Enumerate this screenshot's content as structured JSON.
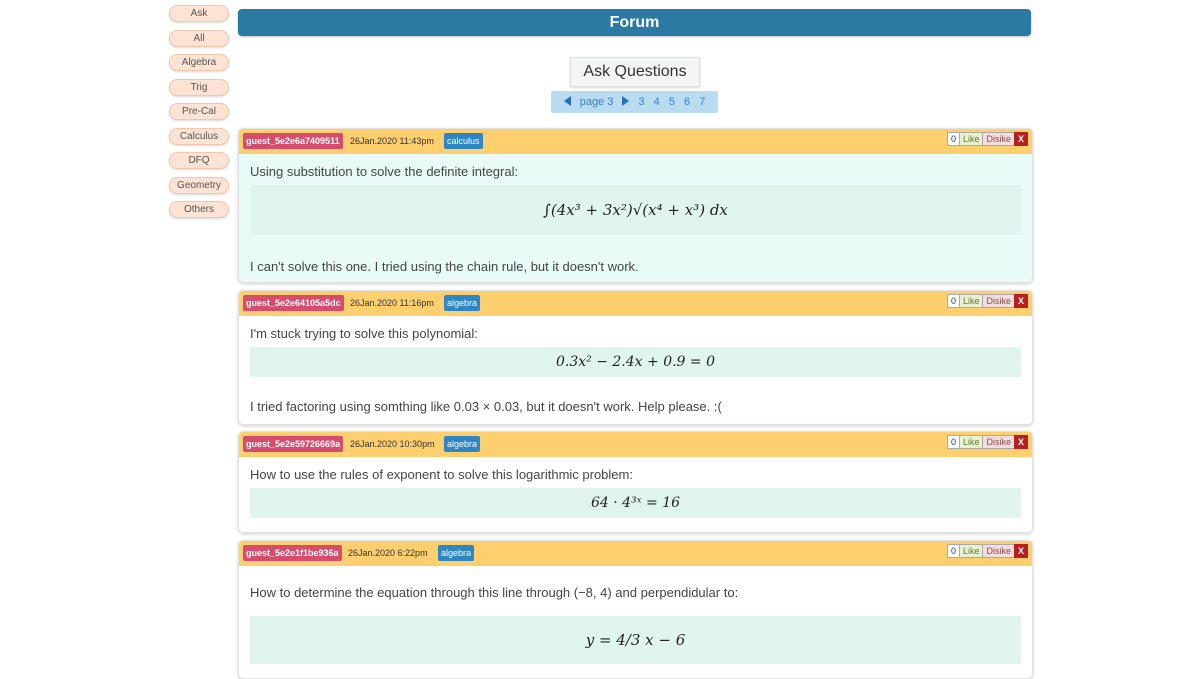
{
  "sidebar": {
    "items": [
      "Ask",
      "All",
      "Algebra",
      "Trig",
      "Pre-Cal",
      "Calculus",
      "DFQ",
      "Geometry",
      "Others"
    ]
  },
  "header": {
    "title": "Forum"
  },
  "ask_button": "Ask Questions",
  "pagination": {
    "current": "page 3",
    "pages": [
      "3",
      "4",
      "5",
      "6",
      "7"
    ]
  },
  "posts": [
    {
      "user": "guest_5e2e6a7409511",
      "date": "26Jan.2020 11:43pm",
      "category": "calculus",
      "votes": {
        "count": "0",
        "like": "Like",
        "dislike": "Disike",
        "close": "X"
      },
      "intro": "Using substitution to solve the definite integral:",
      "equation": "∫(4x³ + 3x²)√(x⁴ + x³) dx",
      "followup": "I can't solve this one. I tried using the chain rule, but it doesn't work."
    },
    {
      "user": "guest_5e2e64105a5dc",
      "date": "26Jan.2020 11:16pm",
      "category": "algebra",
      "votes": {
        "count": "0",
        "like": "Like",
        "dislike": "Disike",
        "close": "X"
      },
      "intro": "I'm stuck trying to solve this polynomial:",
      "equation": "0.3x² − 2.4x + 0.9 = 0",
      "followup": "I tried factoring using somthing like 0.03 × 0.03, but it doesn't work. Help please. :("
    },
    {
      "user": "guest_5e2e59726669a",
      "date": "26Jan.2020 10:30pm",
      "category": "algebra",
      "votes": {
        "count": "0",
        "like": "Like",
        "dislike": "Disike",
        "close": "X"
      },
      "intro": "How to use the rules of exponent to solve this logarithmic problem:",
      "equation": "64 · 4³ˣ = 16"
    },
    {
      "user": "guest_5e2e1f1be936a",
      "date": "26Jan.2020 6:22pm",
      "category": "algebra",
      "votes": {
        "count": "0",
        "like": "Like",
        "dislike": "Disike",
        "close": "X"
      },
      "intro": "How to determine the equation through this line through (−8, 4) and perpendidular to:",
      "equation": "y = 4/3 x − 6"
    }
  ]
}
